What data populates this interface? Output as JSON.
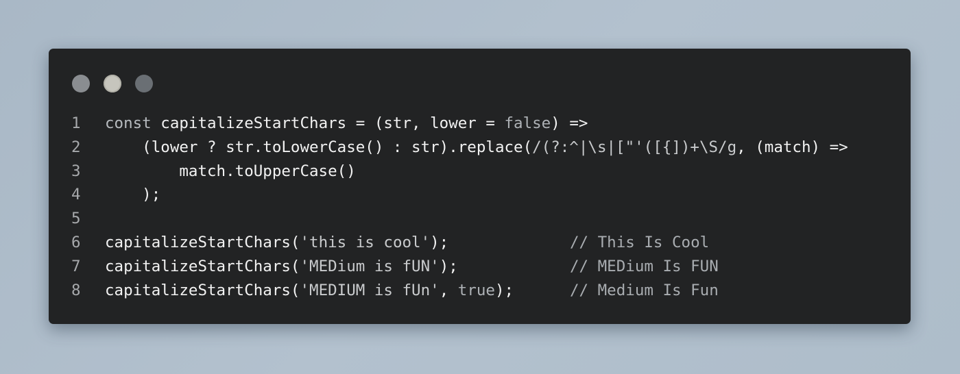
{
  "window": {
    "controls": [
      {
        "name": "close",
        "color": "#8a8d91"
      },
      {
        "name": "minimize",
        "color": "#c6c5bd"
      },
      {
        "name": "maximize",
        "color": "#6a6f74"
      }
    ]
  },
  "code": {
    "lines": [
      {
        "number": "1",
        "tokens": [
          {
            "cls": "t-kw",
            "text": "const "
          },
          {
            "cls": "t-plain",
            "text": "capitalizeStartChars = (str, lower = "
          },
          {
            "cls": "t-lit",
            "text": "false"
          },
          {
            "cls": "t-plain",
            "text": ") =>"
          }
        ]
      },
      {
        "number": "2",
        "tokens": [
          {
            "cls": "t-plain",
            "text": "    (lower ? str.toLowerCase() : str).replace("
          },
          {
            "cls": "t-str",
            "text": "/(?:^|\\s|[\"'([{])+\\S/g"
          },
          {
            "cls": "t-plain",
            "text": ", (match) =>"
          }
        ]
      },
      {
        "number": "3",
        "tokens": [
          {
            "cls": "t-plain",
            "text": "        match.toUpperCase()"
          }
        ]
      },
      {
        "number": "4",
        "tokens": [
          {
            "cls": "t-plain",
            "text": "    );"
          }
        ]
      },
      {
        "number": "5",
        "tokens": []
      },
      {
        "number": "6",
        "tokens": [
          {
            "cls": "t-plain",
            "text": "capitalizeStartChars("
          },
          {
            "cls": "t-str",
            "text": "'this is cool'"
          },
          {
            "cls": "t-plain",
            "text": ");"
          }
        ],
        "comment": "// This Is Cool"
      },
      {
        "number": "7",
        "tokens": [
          {
            "cls": "t-plain",
            "text": "capitalizeStartChars("
          },
          {
            "cls": "t-str",
            "text": "'MEDium is fUN'"
          },
          {
            "cls": "t-plain",
            "text": ");"
          }
        ],
        "comment": "// MEDium Is FUN"
      },
      {
        "number": "8",
        "tokens": [
          {
            "cls": "t-plain",
            "text": "capitalizeStartChars("
          },
          {
            "cls": "t-str",
            "text": "'MEDIUM is fUn'"
          },
          {
            "cls": "t-plain",
            "text": ", "
          },
          {
            "cls": "t-lit",
            "text": "true"
          },
          {
            "cls": "t-plain",
            "text": ");"
          }
        ],
        "comment": "// Medium Is Fun"
      }
    ]
  }
}
